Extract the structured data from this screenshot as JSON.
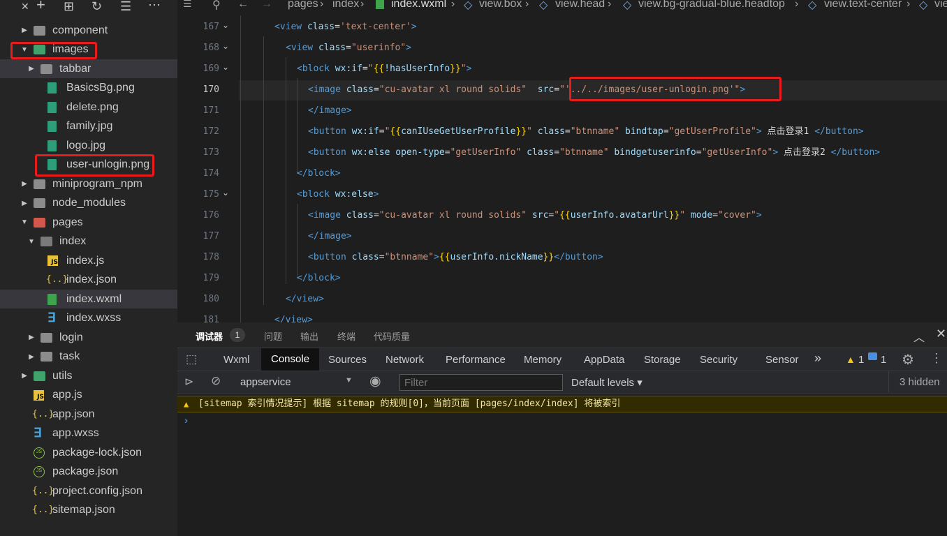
{
  "explorer": {
    "toolbar_icons": [
      "collapse-icon",
      "new-file-icon",
      "new-folder-icon",
      "refresh-icon",
      "sort-icon",
      "more-icon"
    ],
    "items": [
      {
        "label": "component",
        "depth": 0,
        "type": "folder",
        "expanded": false
      },
      {
        "label": "images",
        "depth": 0,
        "type": "folder-images",
        "expanded": true
      },
      {
        "label": "tabbar",
        "depth": 1,
        "type": "folder",
        "expanded": false
      },
      {
        "label": "BasicsBg.png",
        "depth": 1,
        "type": "png"
      },
      {
        "label": "delete.png",
        "depth": 1,
        "type": "png"
      },
      {
        "label": "family.jpg",
        "depth": 1,
        "type": "png"
      },
      {
        "label": "logo.jpg",
        "depth": 1,
        "type": "png"
      },
      {
        "label": "user-unlogin.png",
        "depth": 1,
        "type": "png"
      },
      {
        "label": "miniprogram_npm",
        "depth": 0,
        "type": "folder",
        "expanded": false
      },
      {
        "label": "node_modules",
        "depth": 0,
        "type": "folder",
        "expanded": false
      },
      {
        "label": "pages",
        "depth": 0,
        "type": "folder-pages",
        "expanded": true
      },
      {
        "label": "index",
        "depth": 1,
        "type": "folder-open",
        "expanded": true
      },
      {
        "label": "index.js",
        "depth": 2,
        "type": "js"
      },
      {
        "label": "index.json",
        "depth": 2,
        "type": "json"
      },
      {
        "label": "index.wxml",
        "depth": 2,
        "type": "wxml"
      },
      {
        "label": "index.wxss",
        "depth": 2,
        "type": "wxss"
      },
      {
        "label": "login",
        "depth": 1,
        "type": "folder",
        "expanded": false
      },
      {
        "label": "task",
        "depth": 1,
        "type": "folder",
        "expanded": false
      },
      {
        "label": "utils",
        "depth": 0,
        "type": "folder-utils",
        "expanded": false
      },
      {
        "label": "app.js",
        "depth": 0,
        "type": "js"
      },
      {
        "label": "app.json",
        "depth": 0,
        "type": "json"
      },
      {
        "label": "app.wxss",
        "depth": 0,
        "type": "wxss"
      },
      {
        "label": "package-lock.json",
        "depth": 0,
        "type": "npm"
      },
      {
        "label": "package.json",
        "depth": 0,
        "type": "npm"
      },
      {
        "label": "project.config.json",
        "depth": 0,
        "type": "json"
      },
      {
        "label": "sitemap.json",
        "depth": 0,
        "type": "json"
      }
    ]
  },
  "breadcrumb": [
    "pages",
    "index",
    "index.wxml",
    "view.box",
    "view.head",
    "view.bg-gradual-blue.headtop",
    "view.text-center",
    "vie"
  ],
  "editor": {
    "lines": [
      {
        "num": "167",
        "tokens": [
          [
            "tag",
            "<view "
          ],
          [
            "attr",
            "class"
          ],
          [
            "txt",
            "="
          ],
          [
            "str",
            "'text-center'"
          ],
          [
            "tag",
            ">"
          ]
        ]
      },
      {
        "num": "168",
        "tokens": [
          [
            "tag",
            "<view "
          ],
          [
            "attr",
            "class"
          ],
          [
            "txt",
            "="
          ],
          [
            "str",
            "\"userinfo\""
          ],
          [
            "tag",
            ">"
          ]
        ]
      },
      {
        "num": "169",
        "tokens": [
          [
            "tag",
            "<block "
          ],
          [
            "attr",
            "wx:if"
          ],
          [
            "txt",
            "="
          ],
          [
            "str",
            "\""
          ],
          [
            "brace",
            "{{"
          ],
          [
            "attr",
            "!hasUserInfo"
          ],
          [
            "brace",
            "}}"
          ],
          [
            "str",
            "\""
          ],
          [
            "tag",
            ">"
          ]
        ]
      },
      {
        "num": "170",
        "tokens": [
          [
            "tag",
            "<image "
          ],
          [
            "attr",
            "class"
          ],
          [
            "txt",
            "="
          ],
          [
            "str",
            "\"cu-avatar xl round solids\""
          ],
          [
            "txt",
            "  "
          ],
          [
            "attr",
            "src"
          ],
          [
            "txt",
            "="
          ],
          [
            "str",
            "\"'../../images/user-unlogin.png'\""
          ],
          [
            "tag",
            ">"
          ]
        ]
      },
      {
        "num": "171",
        "tokens": [
          [
            "tag",
            "</image>"
          ]
        ]
      },
      {
        "num": "172",
        "tokens": [
          [
            "tag",
            "<button "
          ],
          [
            "attr",
            "wx:if"
          ],
          [
            "txt",
            "="
          ],
          [
            "str",
            "\""
          ],
          [
            "brace",
            "{{"
          ],
          [
            "attr",
            "canIUseGetUserProfile"
          ],
          [
            "brace",
            "}}"
          ],
          [
            "str",
            "\""
          ],
          [
            "txt",
            " "
          ],
          [
            "attr",
            "class"
          ],
          [
            "txt",
            "="
          ],
          [
            "str",
            "\"btnname\""
          ],
          [
            "txt",
            " "
          ],
          [
            "attr",
            "bindtap"
          ],
          [
            "txt",
            "="
          ],
          [
            "str",
            "\"getUserProfile\""
          ],
          [
            "tag",
            ">"
          ],
          [
            "txt",
            " 点击登录1 "
          ],
          [
            "tag",
            "</button>"
          ]
        ]
      },
      {
        "num": "173",
        "tokens": [
          [
            "tag",
            "<button "
          ],
          [
            "attr",
            "wx:else"
          ],
          [
            "txt",
            " "
          ],
          [
            "attr",
            "open-type"
          ],
          [
            "txt",
            "="
          ],
          [
            "str",
            "\"getUserInfo\""
          ],
          [
            "txt",
            " "
          ],
          [
            "attr",
            "class"
          ],
          [
            "txt",
            "="
          ],
          [
            "str",
            "\"btnname\""
          ],
          [
            "txt",
            " "
          ],
          [
            "attr",
            "bindgetuserinfo"
          ],
          [
            "txt",
            "="
          ],
          [
            "str",
            "\"getUserInfo\""
          ],
          [
            "tag",
            ">"
          ],
          [
            "txt",
            " 点击登录2 "
          ],
          [
            "tag",
            "</button>"
          ]
        ]
      },
      {
        "num": "174",
        "tokens": [
          [
            "tag",
            "</block>"
          ]
        ]
      },
      {
        "num": "175",
        "tokens": [
          [
            "tag",
            "<block "
          ],
          [
            "attr",
            "wx:else"
          ],
          [
            "tag",
            ">"
          ]
        ]
      },
      {
        "num": "176",
        "tokens": [
          [
            "tag",
            "<image "
          ],
          [
            "attr",
            "class"
          ],
          [
            "txt",
            "="
          ],
          [
            "str",
            "\"cu-avatar xl round solids\""
          ],
          [
            "txt",
            " "
          ],
          [
            "attr",
            "src"
          ],
          [
            "txt",
            "="
          ],
          [
            "str",
            "\""
          ],
          [
            "brace",
            "{{"
          ],
          [
            "attr",
            "userInfo.avatarUrl"
          ],
          [
            "brace",
            "}}"
          ],
          [
            "str",
            "\""
          ],
          [
            "txt",
            " "
          ],
          [
            "attr",
            "mode"
          ],
          [
            "txt",
            "="
          ],
          [
            "str",
            "\"cover\""
          ],
          [
            "tag",
            ">"
          ]
        ]
      },
      {
        "num": "177",
        "tokens": [
          [
            "tag",
            "</image>"
          ]
        ]
      },
      {
        "num": "178",
        "tokens": [
          [
            "tag",
            "<button "
          ],
          [
            "attr",
            "class"
          ],
          [
            "txt",
            "="
          ],
          [
            "str",
            "\"btnname\""
          ],
          [
            "tag",
            ">"
          ],
          [
            "brace",
            "{{"
          ],
          [
            "attr",
            "userInfo.nickName"
          ],
          [
            "brace",
            "}}"
          ],
          [
            "tag",
            "</button>"
          ]
        ]
      },
      {
        "num": "179",
        "tokens": [
          [
            "tag",
            "</block>"
          ]
        ]
      },
      {
        "num": "180",
        "tokens": [
          [
            "tag",
            "</view>"
          ]
        ]
      },
      {
        "num": "181",
        "tokens": [
          [
            "tag",
            "</view>"
          ]
        ]
      }
    ]
  },
  "panel": {
    "top_tabs": [
      "调试器",
      "问题",
      "输出",
      "终端",
      "代码质量"
    ],
    "debugger_badge": "1",
    "devtools_tabs": [
      "Wxml",
      "Console",
      "Sources",
      "Network",
      "Performance",
      "Memory",
      "AppData",
      "Storage",
      "Security",
      "Sensor"
    ],
    "more_tabs": "»",
    "warn_count": "1",
    "info_count": "1",
    "context": "appservice",
    "filter_placeholder": "Filter",
    "levels": "Default levels ▾",
    "hidden": "3 hidden",
    "warning_message": "[sitemap 索引情况提示] 根据 sitemap 的规则[0]，当前页面 [pages/index/index] 将被索引",
    "prompt": "›"
  },
  "colors": {
    "highlight": "#e81c1c",
    "warning_bg": "#332b00"
  }
}
